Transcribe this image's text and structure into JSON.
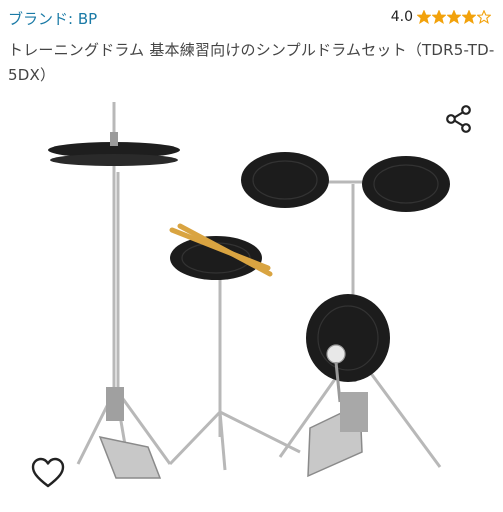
{
  "brand": {
    "label": "ブランド: BP"
  },
  "rating": {
    "value": "4.0",
    "stars": 4,
    "max": 5,
    "color": "#f2a20c"
  },
  "product": {
    "title": "トレーニングドラム 基本練習向けのシンプルドラムセット（TDR5-TD-5DX）",
    "image_icon": "drum-set-image"
  },
  "actions": {
    "share_icon": "share-icon",
    "favorite_icon": "heart-outline-icon"
  }
}
